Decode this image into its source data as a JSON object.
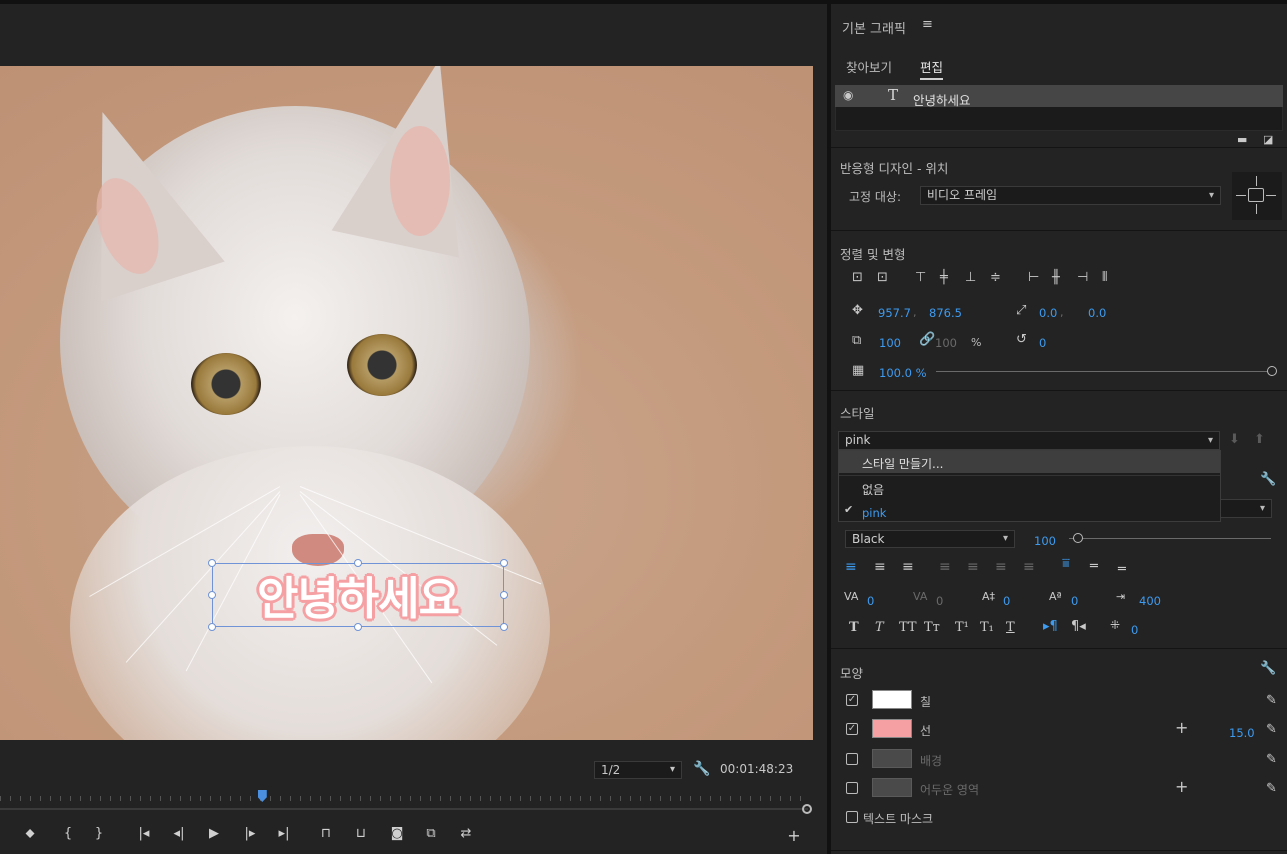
{
  "monitor": {
    "title_text": "안녕하세요",
    "resolution": "1/2",
    "timecode": "00:01:48:23",
    "playhead_fraction": 0.324
  },
  "panel": {
    "title": "기본 그래픽",
    "menu_icon": "hamburger-icon",
    "tabs": [
      {
        "label": "찾아보기",
        "active": false
      },
      {
        "label": "편집",
        "active": true
      }
    ],
    "layer": {
      "name": "안녕하세요",
      "visibility_icon": "eye-icon",
      "type_icon": "text-layer-icon"
    },
    "responsive": {
      "title": "반응형 디자인 - 위치",
      "pin_label": "고정 대상:",
      "pin_value": "비디오 프레임"
    },
    "align": {
      "title": "정렬 및 변형",
      "position_x": "957.7",
      "position_y": "876.5",
      "anchor_x": "0.0",
      "anchor_y": "0.0",
      "scale": "100",
      "scale_width": "100",
      "percent": "%",
      "rotation": "0",
      "opacity": "100.0 %",
      "separator": ","
    },
    "style": {
      "title": "스타일",
      "value": "pink",
      "menu": [
        {
          "label": "스타일 만들기...",
          "checked": false
        },
        {
          "label": "없음",
          "checked": false
        },
        {
          "label": "pink",
          "checked": true
        }
      ]
    },
    "text": {
      "font_style": "Black",
      "font_size": "100",
      "kerning": "0",
      "tracking": "0",
      "leading": "0",
      "baseline": "0",
      "tab_width": "400",
      "tsume": "0"
    },
    "appearance": {
      "title": "모양",
      "fill": {
        "label": "칠",
        "enabled": true,
        "color": "#ffffff"
      },
      "stroke": {
        "label": "선",
        "enabled": true,
        "color": "#f5a0a3",
        "width": "15.0"
      },
      "background": {
        "label": "배경",
        "enabled": false,
        "color": "#4a4a4a"
      },
      "shadow": {
        "label": "어두운 영역",
        "enabled": false,
        "color": "#4a4a4a"
      },
      "mask_label": "텍스트 마스크"
    }
  }
}
